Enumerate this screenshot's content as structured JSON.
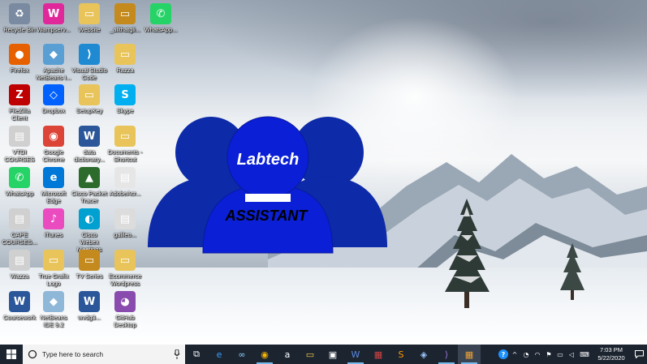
{
  "desktop": {
    "icons": [
      {
        "label": "Recycle Bin",
        "icon": "recycle-bin-icon",
        "color": "#7a8aa0",
        "glyph": "♻"
      },
      {
        "label": "Wampserv...",
        "icon": "wampserver-icon",
        "color": "#e0289b",
        "glyph": "W"
      },
      {
        "label": "Website",
        "icon": "folder-icon",
        "color": "#e8c45a",
        "glyph": "▭"
      },
      {
        "label": "_allthatgli...",
        "icon": "folder-icon",
        "color": "#c48a1e",
        "glyph": "▭"
      },
      {
        "label": "WhatsApp...",
        "icon": "whatsapp-icon",
        "color": "#25d366",
        "glyph": "✆"
      },
      {
        "label": "Firefox",
        "icon": "firefox-icon",
        "color": "#e66000",
        "glyph": "●"
      },
      {
        "label": "Apache NetBeans I...",
        "icon": "netbeans-icon",
        "color": "#5a9fd4",
        "glyph": "◆"
      },
      {
        "label": "Visual Studio Code",
        "icon": "vscode-icon",
        "color": "#1f8ad2",
        "glyph": "⟩"
      },
      {
        "label": "Razza",
        "icon": "folder-icon",
        "color": "#e8c45a",
        "glyph": "▭"
      },
      {
        "label": "FileZilla Client",
        "icon": "filezilla-icon",
        "color": "#bf0000",
        "glyph": "Z"
      },
      {
        "label": "Dropbox",
        "icon": "dropbox-icon",
        "color": "#0061fe",
        "glyph": "◇"
      },
      {
        "label": "SetupKey",
        "icon": "folder-icon",
        "color": "#e8c45a",
        "glyph": "▭"
      },
      {
        "label": "Skype",
        "icon": "skype-icon",
        "color": "#00aff0",
        "glyph": "S"
      },
      {
        "label": "VTDI COURSES",
        "icon": "pdf-icon",
        "color": "#d0d0d0",
        "glyph": "▤"
      },
      {
        "label": "Google Chrome",
        "icon": "chrome-icon",
        "color": "#db4437",
        "glyph": "◉"
      },
      {
        "label": "data dictionary...",
        "icon": "word-doc-icon",
        "color": "#2b579a",
        "glyph": "W"
      },
      {
        "label": "Documents - Shortcut",
        "icon": "folder-shortcut-icon",
        "color": "#e8c45a",
        "glyph": "▭"
      },
      {
        "label": "WhatsApp",
        "icon": "whatsapp-icon",
        "color": "#25d366",
        "glyph": "✆"
      },
      {
        "label": "Microsoft Edge",
        "icon": "edge-icon",
        "color": "#0078d7",
        "glyph": "e"
      },
      {
        "label": "Cisco Packet Tracer",
        "icon": "packet-tracer-icon",
        "color": "#2d6b2d",
        "glyph": "▲"
      },
      {
        "label": "AdobeAcr...",
        "icon": "file-icon",
        "color": "#e6e6e6",
        "glyph": "▤"
      },
      {
        "label": "CAPE COURSES...",
        "icon": "pdf-icon",
        "color": "#d0d0d0",
        "glyph": "▤"
      },
      {
        "label": "iTunes",
        "icon": "itunes-icon",
        "color": "#ea4cc0",
        "glyph": "♪"
      },
      {
        "label": "Cisco Webex Meetings",
        "icon": "webex-icon",
        "color": "#00a0d1",
        "glyph": "◐"
      },
      {
        "label": "galileo...",
        "icon": "file-icon",
        "color": "#dcdcdc",
        "glyph": "▤"
      },
      {
        "label": "Wazza",
        "icon": "pdf-icon",
        "color": "#d0d0d0",
        "glyph": "▤"
      },
      {
        "label": "True Grafix Logo",
        "icon": "folder-icon",
        "color": "#e8c45a",
        "glyph": "▭"
      },
      {
        "label": "TV Series",
        "icon": "folder-icon",
        "color": "#c48a1e",
        "glyph": "▭"
      },
      {
        "label": "Ecommerce Wordpress",
        "icon": "folder-icon",
        "color": "#e8c45a",
        "glyph": "▭"
      },
      {
        "label": "Coursework",
        "icon": "word-doc-icon",
        "color": "#2b579a",
        "glyph": "W"
      },
      {
        "label": "NetBeans IDE 8.2",
        "icon": "netbeans-icon",
        "color": "#8fb8d8",
        "glyph": "◆"
      },
      {
        "label": "wvdg3...",
        "icon": "word-doc-icon",
        "color": "#2b579a",
        "glyph": "W"
      },
      {
        "label": "GitHub Desktop",
        "icon": "github-desktop-icon",
        "color": "#8a4baf",
        "glyph": "◕"
      }
    ]
  },
  "logo": {
    "title": "Labtech",
    "subtitle": "ASSISTANT",
    "colors": {
      "back": "#0d2aa8",
      "front": "#0a1fd6",
      "head": "#0a1fd6"
    }
  },
  "taskbar": {
    "search_placeholder": "Type here to search",
    "apps": [
      {
        "name": "task-view-icon",
        "glyph": "⧉",
        "color": "#ffffff",
        "active": false
      },
      {
        "name": "edge-icon",
        "glyph": "e",
        "color": "#3aa0ff",
        "active": false
      },
      {
        "name": "infinity-app-icon",
        "glyph": "∞",
        "color": "#8fd3ff",
        "active": false
      },
      {
        "name": "chrome-icon",
        "glyph": "◉",
        "color": "#f4b400",
        "active": true
      },
      {
        "name": "amazon-icon",
        "glyph": "a",
        "color": "#ffffff",
        "active": false
      },
      {
        "name": "file-explorer-icon",
        "glyph": "▭",
        "color": "#f3c744",
        "active": false
      },
      {
        "name": "store-icon",
        "glyph": "▣",
        "color": "#ffffff",
        "active": false
      },
      {
        "name": "word-icon",
        "glyph": "W",
        "color": "#5b8be0",
        "active": true
      },
      {
        "name": "winrar-icon",
        "glyph": "▦",
        "color": "#c44",
        "active": false
      },
      {
        "name": "sublime-icon",
        "glyph": "S",
        "color": "#ff9800",
        "active": false
      },
      {
        "name": "virtualbox-icon",
        "glyph": "◈",
        "color": "#9ec8ff",
        "active": false
      },
      {
        "name": "visual-studio-icon",
        "glyph": "⟩",
        "color": "#a07ae0",
        "active": true
      },
      {
        "name": "photos-app-icon",
        "glyph": "▦",
        "color": "#f0a030",
        "active": true
      }
    ],
    "tray": {
      "help_icon": "?",
      "chevron": "^",
      "time": "7:03 PM",
      "date": "5/22/2020"
    }
  }
}
